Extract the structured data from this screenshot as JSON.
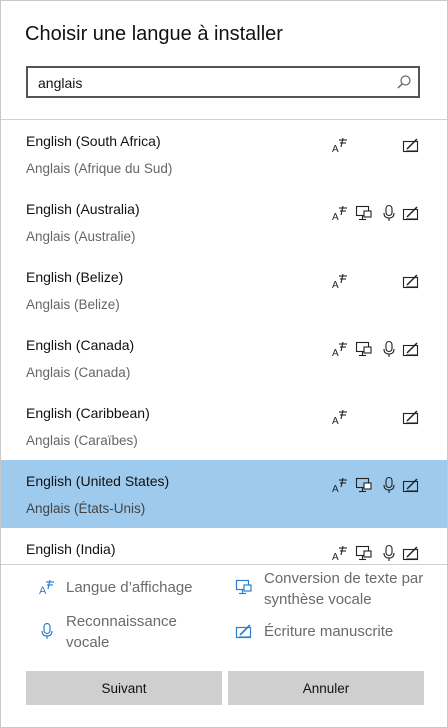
{
  "dialog": {
    "title": "Choisir une langue à installer"
  },
  "search": {
    "value": "anglais",
    "icon": "search-icon"
  },
  "languages": [
    {
      "name": "English (South Africa)",
      "local": "Anglais (Afrique du Sud)",
      "features": [
        "display",
        "handwriting"
      ],
      "selected": false
    },
    {
      "name": "English (Australia)",
      "local": "Anglais (Australie)",
      "features": [
        "display",
        "tts",
        "speech",
        "handwriting"
      ],
      "selected": false
    },
    {
      "name": "English (Belize)",
      "local": "Anglais (Belize)",
      "features": [
        "display",
        "handwriting"
      ],
      "selected": false
    },
    {
      "name": "English (Canada)",
      "local": "Anglais (Canada)",
      "features": [
        "display",
        "tts",
        "speech",
        "handwriting"
      ],
      "selected": false
    },
    {
      "name": "English (Caribbean)",
      "local": "Anglais (Caraïbes)",
      "features": [
        "display",
        "handwriting"
      ],
      "selected": false
    },
    {
      "name": "English (United States)",
      "local": "Anglais (États-Unis)",
      "features": [
        "display",
        "tts",
        "speech",
        "handwriting"
      ],
      "selected": true
    },
    {
      "name": "English (India)",
      "local": "",
      "features": [
        "display",
        "tts",
        "speech",
        "handwriting"
      ],
      "selected": false
    }
  ],
  "legend": {
    "display": "Langue d’affichage",
    "tts": "Conversion de texte par synthèse vocale",
    "speech": "Reconnaissance vocale",
    "handwriting": "Écriture manuscrite"
  },
  "buttons": {
    "next": "Suivant",
    "cancel": "Annuler"
  },
  "colors": {
    "selected_row": "#9ecaee",
    "legend_icon": "#2a7fd4",
    "button": "#cfcfcf"
  }
}
